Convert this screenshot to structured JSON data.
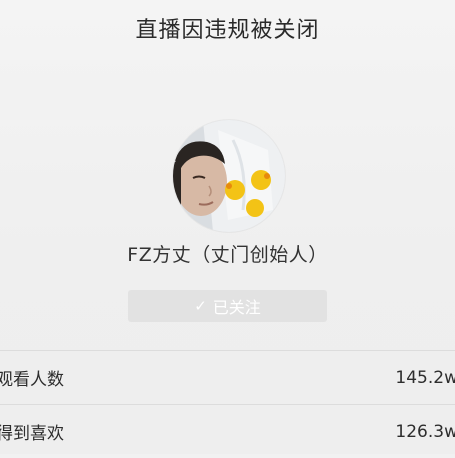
{
  "header": {
    "title": "直播因违规被关闭"
  },
  "streamer": {
    "avatar_icon": "user-avatar-photo",
    "name": "FZ方丈（丈门创始人）"
  },
  "follow_button": {
    "label": "已关注",
    "icon": "check-icon"
  },
  "stats": [
    {
      "label": "观看人数",
      "value": "145.2w"
    },
    {
      "label": "得到喜欢",
      "value": "126.3w"
    }
  ],
  "colors": {
    "background": "#f1f1f1",
    "button_bg": "#e2e2e2",
    "divider": "#dcdcdc"
  }
}
